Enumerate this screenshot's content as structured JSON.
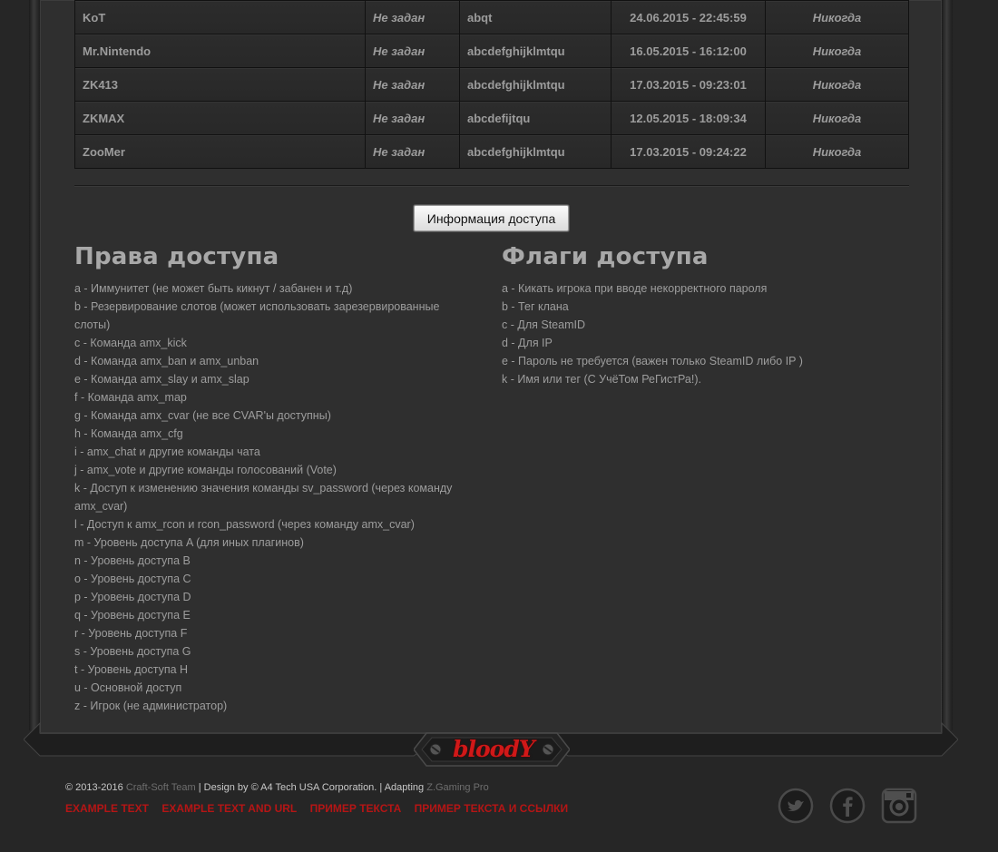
{
  "table": {
    "rows": [
      {
        "name": "KoT",
        "pass": "Не задан",
        "flags": "abqt",
        "date": "24.06.2015 - 22:45:59",
        "expires": "Никогда"
      },
      {
        "name": "Mr.Nintendo",
        "pass": "Не задан",
        "flags": "abcdefghijklmtqu",
        "date": "16.05.2015 - 16:12:00",
        "expires": "Никогда"
      },
      {
        "name": "ZK413",
        "pass": "Не задан",
        "flags": "abcdefghijklmtqu",
        "date": "17.03.2015 - 09:23:01",
        "expires": "Никогда"
      },
      {
        "name": "ZKMAX",
        "pass": "Не задан",
        "flags": "abcdefijtqu",
        "date": "12.05.2015 - 18:09:34",
        "expires": "Никогда"
      },
      {
        "name": "ZooMer",
        "pass": "Не задан",
        "flags": "abcdefghijklmtqu",
        "date": "17.03.2015 - 09:24:22",
        "expires": "Никогда"
      }
    ]
  },
  "info_button": "Информация доступа",
  "rights": {
    "title": "Права доступа",
    "items": [
      "a - Иммунитет (не может быть кикнут / забанен и т.д)",
      "b - Резервирование слотов (может использовать зарезервированные слоты)",
      "c - Команда amx_kick",
      "d - Команда amx_ban и amx_unban",
      "e - Команда amx_slay и amx_slap",
      "f - Команда amx_map",
      "g - Команда amx_cvar (не все CVAR'ы доступны)",
      "h - Команда amx_cfg",
      "i - amx_chat и другие команды чата",
      "j - amx_vote и другие команды голосований (Vote)",
      "k - Доступ к изменению значения команды sv_password (через команду amx_cvar)",
      "l - Доступ к amx_rcon и rcon_password (через команду amx_cvar)",
      "m - Уровень доступа A (для иных плагинов)",
      "n - Уровень доступа B",
      "o - Уровень доступа C",
      "p - Уровень доступа D",
      "q - Уровень доступа E",
      "r - Уровень доступа F",
      "s - Уровень доступа G",
      "t - Уровень доступа H",
      "u - Основной доступ",
      "z - Игрок (не администратор)"
    ]
  },
  "flags": {
    "title": "Флаги доступа",
    "items": [
      "a - Кикать игрока при вводе некорректного пароля",
      "b - Тег клана",
      "c - Для SteamID",
      "d - Для IP",
      "e - Пароль не требуется (важен только SteamID либо IP )",
      "k - Имя или тег (С УчёТом РеГистРа!)."
    ]
  },
  "logo": "bloodY",
  "footer": {
    "copyright_prefix": "© 2013-2016",
    "team_link": "Craft-Soft Team",
    "design_text": "| Design by © A4 Tech USA Corporation. | Adapting",
    "adapt_link": "Z.Gaming Pro",
    "links": [
      "EXAMPLE TEXT",
      "EXAMPLE TEXT AND URL",
      "ПРИМЕР ТЕКСТА",
      "ПРИМЕР ТЕКСТА И ССЫЛКИ"
    ],
    "social_icons": [
      "twitter-icon",
      "facebook-icon",
      "instagram-icon"
    ]
  },
  "colors": {
    "accent_red": "#d01818",
    "link_red": "#b51515",
    "text": "#9d9d9d"
  }
}
